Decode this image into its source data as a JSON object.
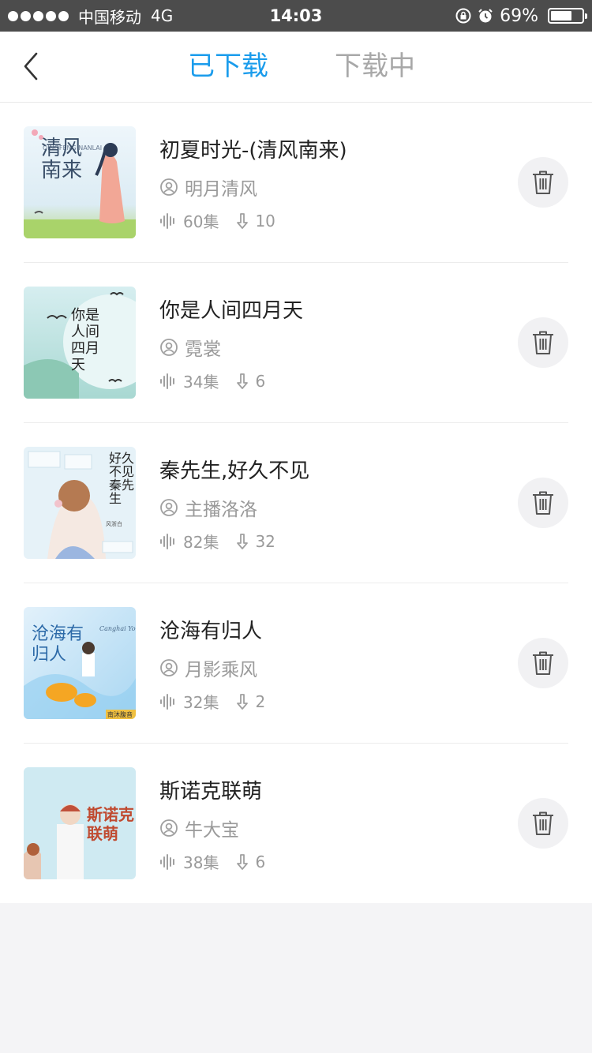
{
  "status_bar": {
    "carrier": "中国移动",
    "network": "4G",
    "time": "14:03",
    "battery": "69%",
    "battery_level": 0.69
  },
  "nav": {
    "back_icon": "chevron-left-icon",
    "tabs": [
      {
        "label": "已下载",
        "active": true
      },
      {
        "label": "下载中",
        "active": false
      }
    ]
  },
  "colors": {
    "accent": "#1a9cec",
    "inactive_tab": "#a8a8a8",
    "text": "#222222",
    "meta": "#9a9a9a"
  },
  "items": [
    {
      "title": "初夏时光-(清风南来)",
      "anchor": "明月清风",
      "episodes": "60集",
      "downloads": "10"
    },
    {
      "title": "你是人间四月天",
      "anchor": "霓裳",
      "episodes": "34集",
      "downloads": "6"
    },
    {
      "title": "秦先生,好久不见",
      "anchor": "主播洛洛",
      "episodes": "82集",
      "downloads": "32"
    },
    {
      "title": "沧海有归人",
      "anchor": "月影乘风",
      "episodes": "32集",
      "downloads": "2"
    },
    {
      "title": "斯诺克联萌",
      "anchor": "牛大宝",
      "episodes": "38集",
      "downloads": "6"
    }
  ],
  "covers": [
    {
      "text": "清风南来",
      "subtext": "QINGFENG NANLAI"
    },
    {
      "text": "你是人间四月天"
    },
    {
      "text": "好久不见秦先生",
      "subtext": "风浙白"
    },
    {
      "text": "沧海有归人",
      "subtext": "Canghai Youguiren",
      "badge": "南沐腹音"
    },
    {
      "text": "斯诺克联萌"
    }
  ]
}
